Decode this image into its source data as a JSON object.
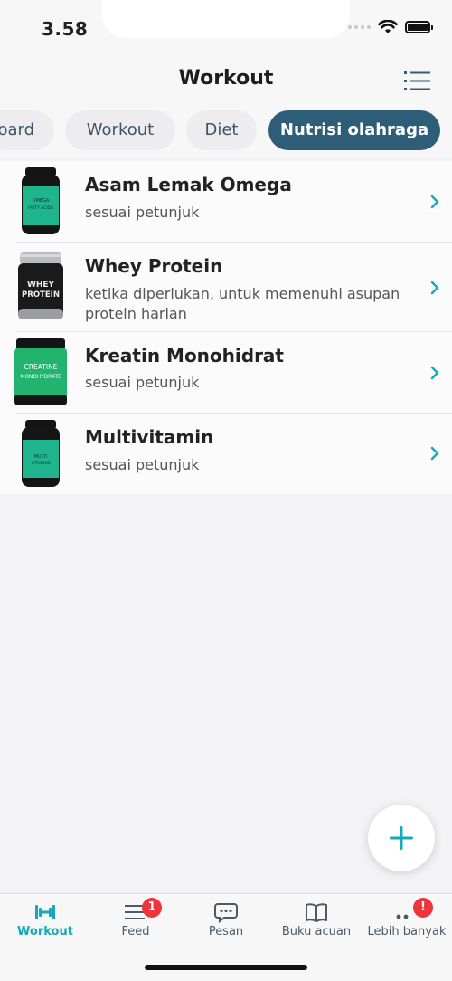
{
  "status_bar": {
    "time": "3.58"
  },
  "header": {
    "title": "Workout",
    "menu_icon": "list-menu-icon"
  },
  "tabs": [
    {
      "label": "oard",
      "active": false
    },
    {
      "label": "Workout",
      "active": false
    },
    {
      "label": "Diet",
      "active": false
    },
    {
      "label": "Nutrisi olahraga",
      "active": true
    }
  ],
  "supplements": [
    {
      "title": "Asam Lemak Omega",
      "subtitle": "sesuai petunjuk",
      "product_label": [
        "OMEGA",
        "FATTY ACIDS"
      ],
      "jar_color": "#1fb58f"
    },
    {
      "title": "Whey Protein",
      "subtitle": "ketika diperlukan, untuk memenuhi asupan protein harian",
      "product_label": [
        "WHEY",
        "PROTEIN"
      ],
      "jar_color": "#1b1b1b"
    },
    {
      "title": "Kreatin Monohidrat",
      "subtitle": "sesuai petunjuk",
      "product_label": [
        "CREATINE",
        "MONOHYDRATE"
      ],
      "jar_color": "#22b36e"
    },
    {
      "title": "Multivitamin",
      "subtitle": "sesuai petunjuk",
      "product_label": [
        "MULTI",
        "VITAMINS"
      ],
      "jar_color": "#1fb58f"
    }
  ],
  "fab": {
    "icon": "plus-icon"
  },
  "bottom_nav": [
    {
      "label": "Workout",
      "icon": "dumbbell-icon",
      "active": true,
      "badge": ""
    },
    {
      "label": "Feed",
      "icon": "feed-icon",
      "active": false,
      "badge": "1"
    },
    {
      "label": "Pesan",
      "icon": "chat-bubble-icon",
      "active": false,
      "badge": ""
    },
    {
      "label": "Buku acuan",
      "icon": "book-icon",
      "active": false,
      "badge": ""
    },
    {
      "label": "Lebih banyak",
      "icon": "more-dots-icon",
      "active": false,
      "badge": "!"
    }
  ],
  "colors": {
    "accent": "#16a9b8",
    "active_tab": "#2e5d78",
    "badge": "#f0343c"
  }
}
